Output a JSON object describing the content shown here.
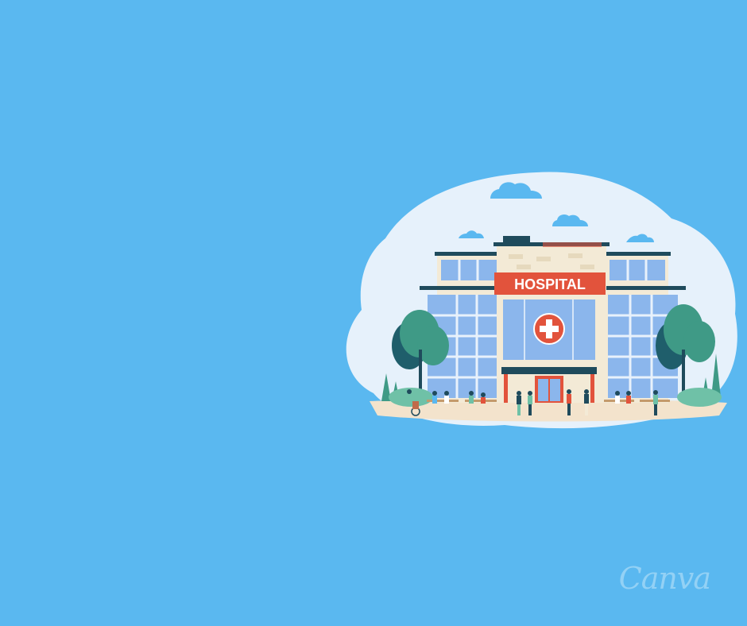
{
  "canvas": {
    "background": "#5ab8f0"
  },
  "illustration": {
    "sign_text": "HOSPITAL",
    "icon": "hospital-cross-icon",
    "colors": {
      "blob": "#e6f1fb",
      "cloud": "#5ab8f0",
      "wall": "#f3ead6",
      "glass": "#8bb6ec",
      "sign": "#e2533c",
      "tree": "#3f9a86",
      "tree_dark": "#1f5e6b",
      "ground": "#f3e3cc"
    }
  },
  "watermark": {
    "text": "Canva"
  }
}
